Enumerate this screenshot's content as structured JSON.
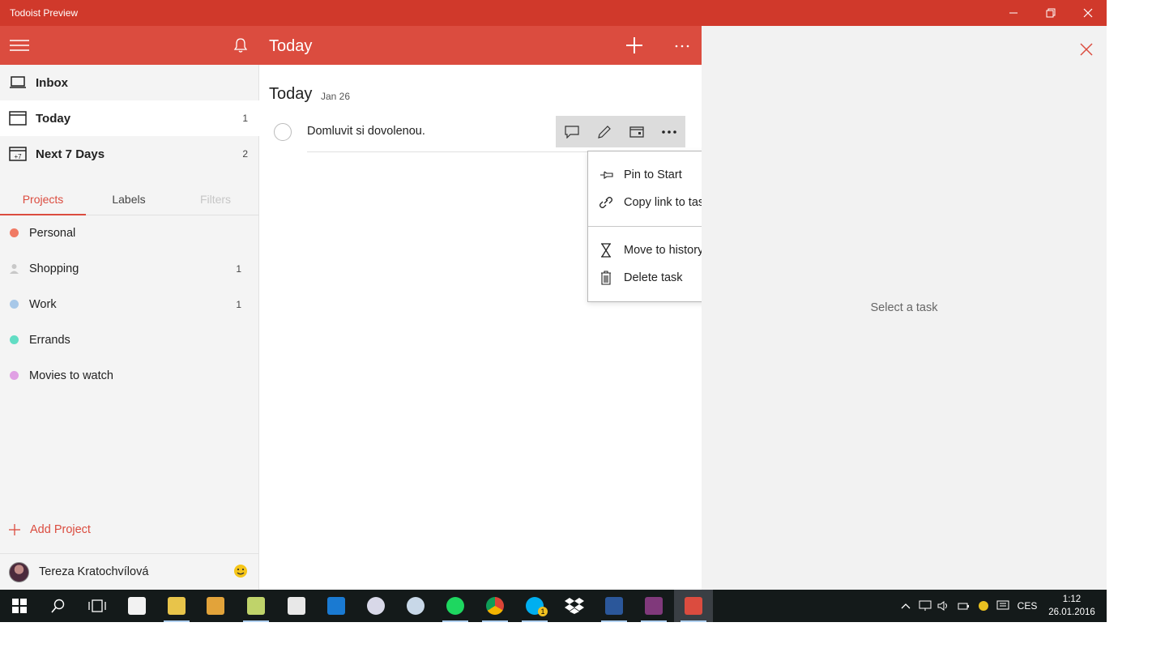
{
  "window": {
    "title": "Todoist Preview"
  },
  "sidebar": {
    "nav": [
      {
        "label": "Inbox",
        "count": ""
      },
      {
        "label": "Today",
        "count": "1"
      },
      {
        "label": "Next 7 Days",
        "count": "2",
        "icon_text": "+7"
      }
    ],
    "tabs": [
      {
        "label": "Projects",
        "state": "selected"
      },
      {
        "label": "Labels",
        "state": "normal"
      },
      {
        "label": "Filters",
        "state": "disabled"
      }
    ],
    "projects": [
      {
        "label": "Personal",
        "count": "",
        "color": "#f07a64"
      },
      {
        "label": "Shopping",
        "count": "1",
        "color": "#c8c8c8"
      },
      {
        "label": "Work",
        "count": "1",
        "color": "#a8c8e8"
      },
      {
        "label": "Errands",
        "count": "",
        "color": "#62ddc4"
      },
      {
        "label": "Movies to watch",
        "count": "",
        "color": "#e0a0e4"
      }
    ],
    "add_project_label": "Add Project",
    "user_name": "Tereza Kratochvílová"
  },
  "main": {
    "header_title": "Today",
    "section_title": "Today",
    "section_date": "Jan 26",
    "task_text": "Domluvit si dovolenou."
  },
  "context_menu": {
    "items": [
      {
        "label": "Pin to Start",
        "icon": "pin-icon"
      },
      {
        "label": "Copy link to task",
        "icon": "link-icon"
      },
      {
        "label": "Move to history",
        "icon": "hourglass-icon"
      },
      {
        "label": "Delete task",
        "icon": "trash-icon"
      }
    ]
  },
  "detail": {
    "empty_text": "Select a task"
  },
  "taskbar": {
    "language": "CES",
    "time": "1:12",
    "date": "26.01.2016",
    "skype_badge": "1"
  },
  "colors": {
    "accent": "#db4c3f",
    "titlebar": "#d0392b",
    "sidebar_bg": "#f4f4f4",
    "detail_bg": "#f2f2f2",
    "taskbar_bg": "#141a1a"
  }
}
